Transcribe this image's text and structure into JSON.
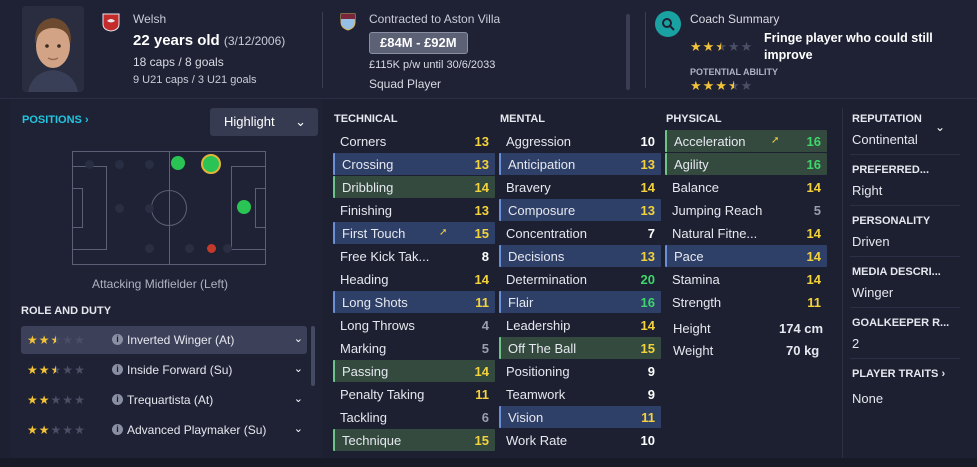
{
  "header": {
    "nationality": "Welsh",
    "age_text": "22 years old",
    "dob": "(3/12/2006)",
    "caps": "18 caps / 8 goals",
    "u21": "9 U21 caps / 3 U21 goals",
    "contract": "Contracted to Aston Villa",
    "value": "£84M - £92M",
    "wage": "£115K p/w until 30/6/2033",
    "squad_status": "Squad Player",
    "coach_title": "Coach Summary",
    "coach_text": "Fringe player who could still improve",
    "potential_label": "POTENTIAL ABILITY",
    "current_ability_stars": 2.5,
    "potential_ability_stars": 3.5
  },
  "positions": {
    "title": "POSITIONS",
    "highlight_label": "Highlight",
    "position_name": "Attacking Midfielder (Left)"
  },
  "roles": {
    "title": "ROLE AND DUTY",
    "items": [
      {
        "name": "Inverted Winger (At)",
        "stars": 2.5
      },
      {
        "name": "Inside Forward (Su)",
        "stars": 2.5
      },
      {
        "name": "Trequartista (At)",
        "stars": 2
      },
      {
        "name": "Advanced Playmaker (Su)",
        "stars": 2
      }
    ]
  },
  "technical": {
    "title": "TECHNICAL",
    "items": [
      {
        "name": "Corners",
        "value": "13"
      },
      {
        "name": "Crossing",
        "value": "13"
      },
      {
        "name": "Dribbling",
        "value": "14"
      },
      {
        "name": "Finishing",
        "value": "13"
      },
      {
        "name": "First Touch",
        "value": "15"
      },
      {
        "name": "Free Kick Tak...",
        "value": "8"
      },
      {
        "name": "Heading",
        "value": "14"
      },
      {
        "name": "Long Shots",
        "value": "11"
      },
      {
        "name": "Long Throws",
        "value": "4"
      },
      {
        "name": "Marking",
        "value": "5"
      },
      {
        "name": "Passing",
        "value": "14"
      },
      {
        "name": "Penalty Taking",
        "value": "11"
      },
      {
        "name": "Tackling",
        "value": "6"
      },
      {
        "name": "Technique",
        "value": "15"
      }
    ]
  },
  "mental": {
    "title": "MENTAL",
    "items": [
      {
        "name": "Aggression",
        "value": "10"
      },
      {
        "name": "Anticipation",
        "value": "13"
      },
      {
        "name": "Bravery",
        "value": "14"
      },
      {
        "name": "Composure",
        "value": "13"
      },
      {
        "name": "Concentration",
        "value": "7"
      },
      {
        "name": "Decisions",
        "value": "13"
      },
      {
        "name": "Determination",
        "value": "20"
      },
      {
        "name": "Flair",
        "value": "16"
      },
      {
        "name": "Leadership",
        "value": "14"
      },
      {
        "name": "Off The Ball",
        "value": "15"
      },
      {
        "name": "Positioning",
        "value": "9"
      },
      {
        "name": "Teamwork",
        "value": "9"
      },
      {
        "name": "Vision",
        "value": "11"
      },
      {
        "name": "Work Rate",
        "value": "10"
      }
    ]
  },
  "physical": {
    "title": "PHYSICAL",
    "items": [
      {
        "name": "Acceleration",
        "value": "16"
      },
      {
        "name": "Agility",
        "value": "16"
      },
      {
        "name": "Balance",
        "value": "14"
      },
      {
        "name": "Jumping Reach",
        "value": "5"
      },
      {
        "name": "Natural Fitne...",
        "value": "14"
      },
      {
        "name": "Pace",
        "value": "14"
      },
      {
        "name": "Stamina",
        "value": "14"
      },
      {
        "name": "Strength",
        "value": "11"
      }
    ],
    "height_label": "Height",
    "height_value": "174 cm",
    "weight_label": "Weight",
    "weight_value": "70 kg"
  },
  "sidebar": {
    "reputation_label": "REPUTATION",
    "reputation_value": "Continental",
    "preferred_label": "PREFERRED...",
    "preferred_value": "Right",
    "personality_label": "PERSONALITY",
    "personality_value": "Driven",
    "media_label": "MEDIA DESCRI...",
    "media_value": "Winger",
    "gk_label": "GOALKEEPER R...",
    "gk_value": "2",
    "traits_label": "PLAYER TRAITS",
    "traits_value": "None"
  },
  "colors": {
    "highlight_blue": "#2f4068",
    "highlight_green": "#344a3f",
    "value_yellow": "#f4d23c",
    "value_green": "#3ed66a",
    "accent_cyan": "#22c6e0"
  }
}
